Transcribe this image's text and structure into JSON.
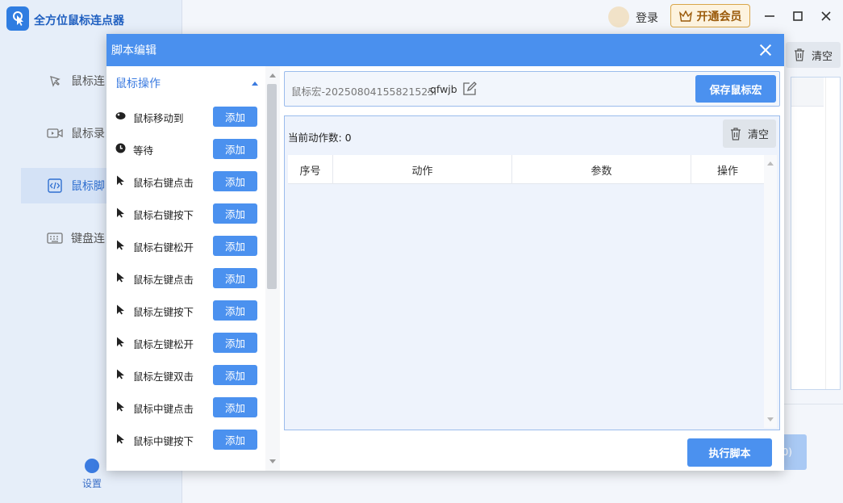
{
  "app": {
    "title": "全方位鼠标连点器",
    "login_label": "登录",
    "vip_label": "开通会员",
    "accent_color": "#4a90ee"
  },
  "sidebar": {
    "items": [
      {
        "label": "鼠标连",
        "icon": "mouse-click-icon"
      },
      {
        "label": "鼠标录",
        "icon": "video-record-icon"
      },
      {
        "label": "鼠标脚",
        "icon": "code-script-icon"
      },
      {
        "label": "键盘连",
        "icon": "keyboard-icon"
      }
    ],
    "settings_label": "设置"
  },
  "background": {
    "clear_label": "清空",
    "run_suffix": "0)"
  },
  "modal": {
    "title": "脚本编辑",
    "category": "鼠标操作",
    "add_label": "添加",
    "actions": [
      {
        "label": "鼠标移动到",
        "icon": "mouse-move-icon"
      },
      {
        "label": "等待",
        "icon": "clock-icon"
      },
      {
        "label": "鼠标右键点击",
        "icon": "cursor-icon"
      },
      {
        "label": "鼠标右键按下",
        "icon": "cursor-icon"
      },
      {
        "label": "鼠标右键松开",
        "icon": "cursor-icon"
      },
      {
        "label": "鼠标左键点击",
        "icon": "cursor-icon"
      },
      {
        "label": "鼠标左键按下",
        "icon": "cursor-icon"
      },
      {
        "label": "鼠标左键松开",
        "icon": "cursor-icon"
      },
      {
        "label": "鼠标左键双击",
        "icon": "cursor-icon"
      },
      {
        "label": "鼠标中键点击",
        "icon": "cursor-icon"
      },
      {
        "label": "鼠标中键按下",
        "icon": "cursor-icon"
      }
    ],
    "script_name": "鼠标宏-20250804155821525",
    "script_ext": ".qfwjb",
    "save_label": "保存鼠标宏",
    "action_count_label": "当前动作数: 0",
    "clear_label": "清空",
    "table_headers": [
      "序号",
      "动作",
      "参数",
      "操作"
    ],
    "run_label": "执行脚本"
  }
}
